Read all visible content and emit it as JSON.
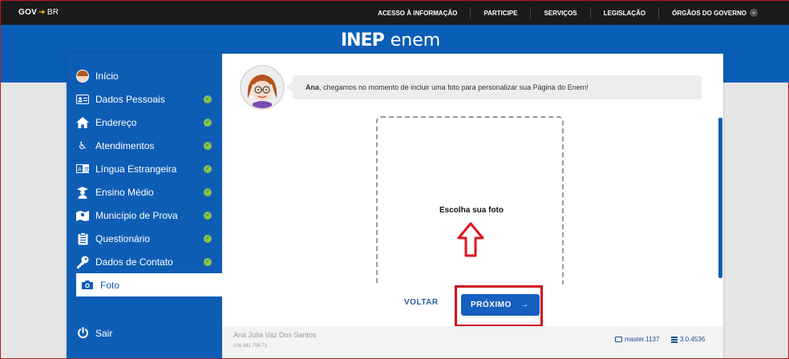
{
  "topbar": {
    "logo_gov": "GOV",
    "logo_br": "BR",
    "nav": [
      "ACESSO À INFORMAÇÃO",
      "PARTICIPE",
      "SERVIÇOS",
      "LEGISLAÇÃO",
      "ÓRGÃOS DO GOVERNO"
    ]
  },
  "brand": {
    "inep": "INEP",
    "enem": "enem"
  },
  "sidebar": {
    "items": [
      {
        "label": "Início",
        "icon": "avatar-icon",
        "check": false
      },
      {
        "label": "Dados Pessoais",
        "icon": "id-card-icon",
        "check": true
      },
      {
        "label": "Endereço",
        "icon": "home-icon",
        "check": true
      },
      {
        "label": "Atendimentos",
        "icon": "wheelchair-icon",
        "check": true
      },
      {
        "label": "Língua Estrangeira",
        "icon": "language-icon",
        "check": true
      },
      {
        "label": "Ensino Médio",
        "icon": "graduate-icon",
        "check": true
      },
      {
        "label": "Município de Prova",
        "icon": "map-icon",
        "check": true
      },
      {
        "label": "Questionário",
        "icon": "clipboard-icon",
        "check": true
      },
      {
        "label": "Dados de Contato",
        "icon": "key-icon",
        "check": true
      },
      {
        "label": "Foto",
        "icon": "camera-icon",
        "check": false
      }
    ],
    "logout": "Sair"
  },
  "message": {
    "name": "Ana",
    "text": ", chegamos no momento de incluir uma foto para personalizar sua Página do Enem!"
  },
  "photo": {
    "label": "Escolha sua foto"
  },
  "buttons": {
    "back": "VOLTAR",
    "next": "PRÓXIMO",
    "next_arrow": "→"
  },
  "footer": {
    "user_name": "Ana Julia Vaz Dos Santos",
    "cpf": "106.341.759-71",
    "master": "master.1137",
    "version": "3.0.4536"
  },
  "colors": {
    "sidebar": "#0e5db5",
    "header": "#0b5eb7",
    "highlight": "#d0101e",
    "check": "#8bc34a"
  }
}
